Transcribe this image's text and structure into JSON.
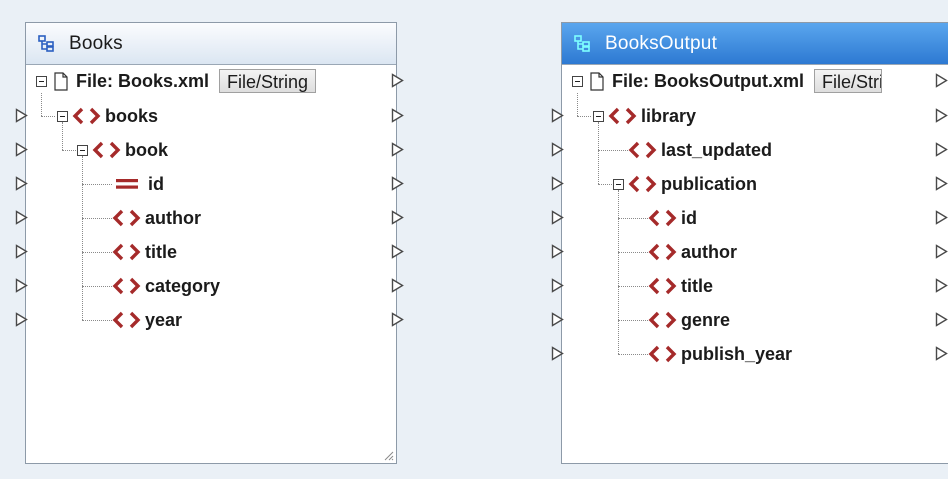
{
  "colors": {
    "background": "#eaf0f6",
    "active_header": "#2d79d2",
    "element_icon": "#a52a2a",
    "connector": "#4a4a4a"
  },
  "source": {
    "title": "Books",
    "file_label": "File: Books.xml",
    "file_button": "File/String",
    "nodes": {
      "books": "books",
      "book": "book",
      "id": "id",
      "author": "author",
      "title": "title",
      "category": "category",
      "year": "year"
    }
  },
  "target": {
    "title": "BooksOutput",
    "file_label": "File: BooksOutput.xml",
    "file_button": "File/String",
    "nodes": {
      "library": "library",
      "last_updated": "last_updated",
      "publication": "publication",
      "id": "id",
      "author": "author",
      "title": "title",
      "genre": "genre",
      "publish_year": "publish_year"
    }
  }
}
